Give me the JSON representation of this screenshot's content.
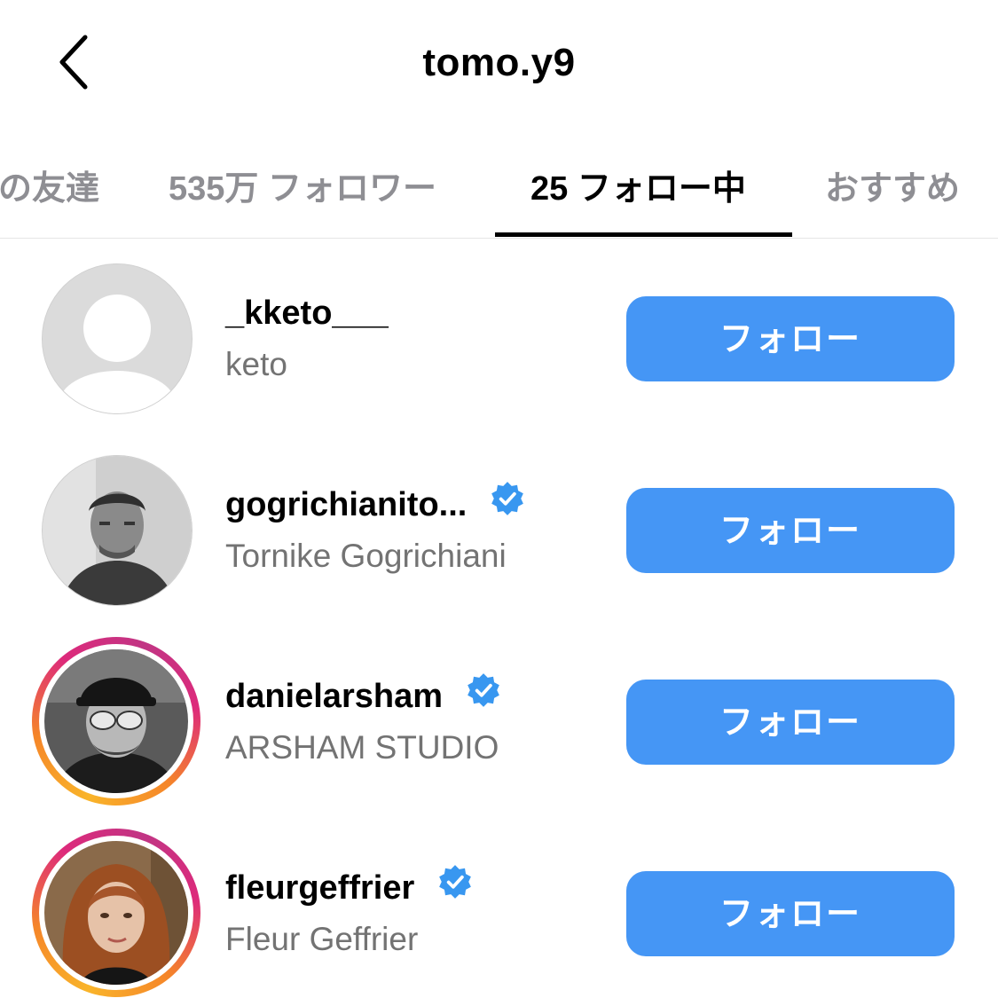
{
  "header": {
    "title": "tomo.y9"
  },
  "tabs": [
    {
      "label": "の友達"
    },
    {
      "label": "535万 フォロワー"
    },
    {
      "label": "25 フォロー中"
    },
    {
      "label": "おすすめ"
    }
  ],
  "colors": {
    "follow_button": "#4596f5",
    "verified": "#3897f0",
    "secondary_text": "#737373"
  },
  "users": [
    {
      "username": "_kketo___",
      "full_name": "keto",
      "verified": false,
      "story_ring": false,
      "button": "フォロー"
    },
    {
      "username": "gogrichianito...",
      "full_name": "Tornike Gogrichiani",
      "verified": true,
      "story_ring": false,
      "button": "フォロー"
    },
    {
      "username": "danielarsham",
      "full_name": "ARSHAM STUDIO",
      "verified": true,
      "story_ring": true,
      "button": "フォロー"
    },
    {
      "username": "fleurgeffrier",
      "full_name": "Fleur Geffrier",
      "verified": true,
      "story_ring": true,
      "button": "フォロー"
    }
  ]
}
